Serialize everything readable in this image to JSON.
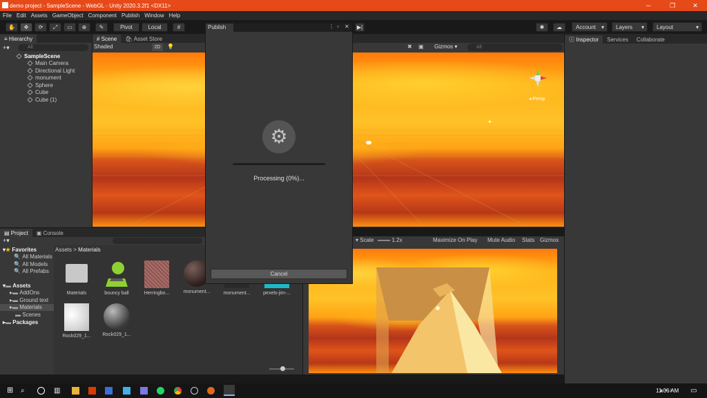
{
  "window": {
    "title": "demo project - SampleScene - WebGL - Unity 2020.3.2f1 <DX11>",
    "minimize": "─",
    "maximize": "❐",
    "close": "✕"
  },
  "menu": [
    "File",
    "Edit",
    "Assets",
    "GameObject",
    "Component",
    "Publish",
    "Window",
    "Help"
  ],
  "toolbar": {
    "pivot": "Pivot",
    "local": "Local",
    "account": "Account",
    "layers": "Layers",
    "layout": "Layout"
  },
  "hierarchy": {
    "tab": "Hierarchy",
    "search_placeholder": "All",
    "scene": "SampleScene",
    "items": [
      "Main Camera",
      "Directional Light",
      "monument",
      "Sphere",
      "Cube",
      "Cube (1)"
    ]
  },
  "scene_view": {
    "tab_scene": "Scene",
    "tab_asset_store": "Asset Store",
    "shading": "Shaded",
    "mode_2d": "2D",
    "gizmos": "Gizmos",
    "search_placeholder": "All",
    "persp": "Persp"
  },
  "game_view": {
    "scale_label": "Scale",
    "scale_value": "1.2x",
    "maximize": "Maximize On Play",
    "mute": "Mute Audio",
    "stats": "Stats",
    "gizmos": "Gizmos"
  },
  "inspector": {
    "tabs": [
      "Inspector",
      "Services",
      "Collaborate"
    ]
  },
  "project": {
    "tab_project": "Project",
    "tab_console": "Console",
    "favorites_label": "Favorites",
    "favorites": [
      "All Materials",
      "All Models",
      "All Prefabs"
    ],
    "assets_label": "Assets",
    "assets": [
      "AddOns",
      "Ground text",
      "Materials",
      "Scenes"
    ],
    "packages_label": "Packages",
    "breadcrumb_root": "Assets",
    "breadcrumb_sep": ">",
    "breadcrumb_current": "Materials",
    "files": [
      "Materials",
      "bouncy ball",
      "Herringbo...",
      "monument...",
      "monument...",
      "pexels-jim-...",
      "Rock029_1...",
      "Rock029_1..."
    ]
  },
  "publish_dialog": {
    "title": "Publish",
    "status": "Processing (0%)...",
    "progress": 0,
    "cancel": "Cancel"
  },
  "taskbar": {
    "time": "11:06 AM"
  }
}
